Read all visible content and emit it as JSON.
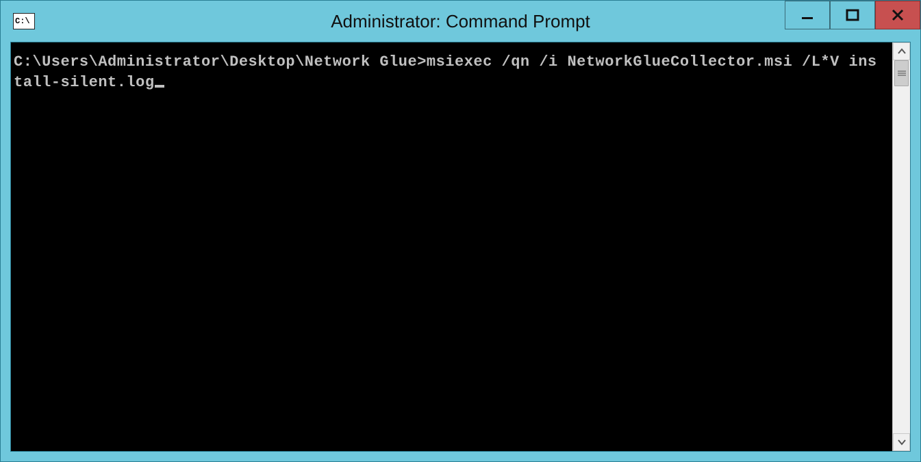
{
  "window": {
    "title": "Administrator: Command Prompt",
    "icon_name": "cmd-icon"
  },
  "controls": {
    "minimize_label": "Minimize",
    "maximize_label": "Maximize",
    "close_label": "Close"
  },
  "console": {
    "prompt": "C:\\Users\\Administrator\\Desktop\\Network Glue>",
    "command": "msiexec /qn /i NetworkGlueCollector.msi /L*V install-silent.log"
  }
}
